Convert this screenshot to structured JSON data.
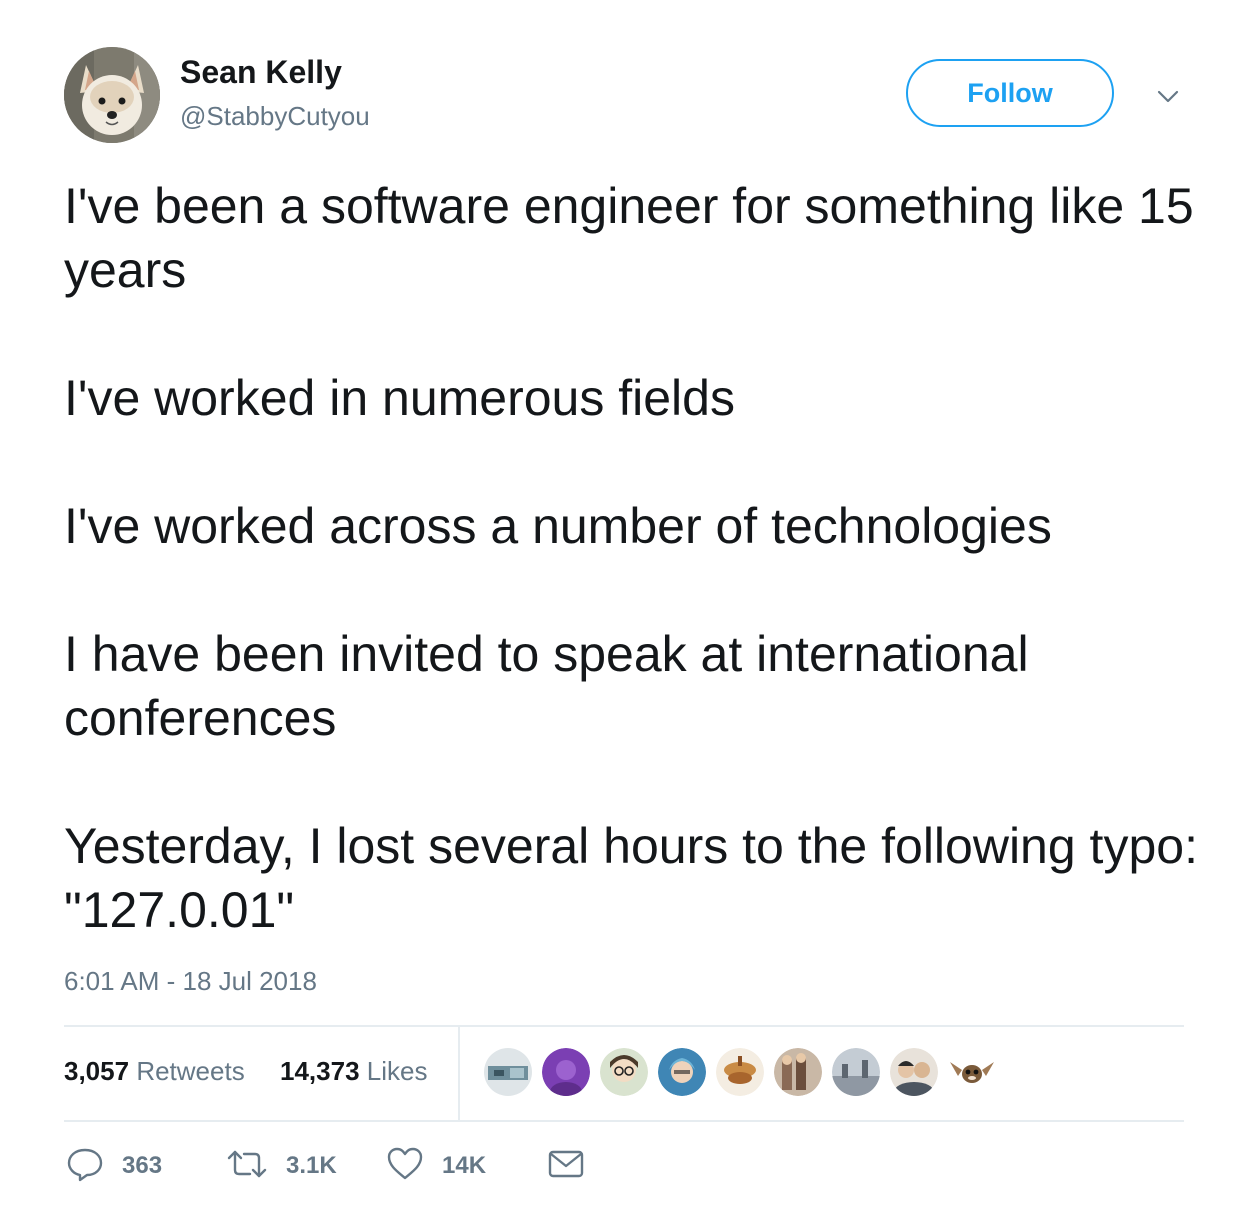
{
  "author": {
    "display_name": "Sean Kelly",
    "handle": "@StabbyCutyou",
    "avatar_icon": "dog-avatar"
  },
  "follow_button": {
    "label": "Follow"
  },
  "menu": {
    "icon": "chevron-down-icon"
  },
  "tweet": {
    "paragraphs": [
      "I've been a software engineer for something like 15 years",
      "I've worked in numerous fields",
      "I've worked across a number of technologies",
      "I have been invited to speak at international conferences",
      "Yesterday, I lost several hours to the following typo: \"127.0.01\""
    ],
    "timestamp": "6:01 AM - 18 Jul 2018"
  },
  "stats": {
    "retweets_count": "3,057",
    "retweets_label": "Retweets",
    "likes_count": "14,373",
    "likes_label": "Likes"
  },
  "likers": [
    {
      "icon": "liker-avatar-1",
      "color": "#6f8f9c"
    },
    {
      "icon": "liker-avatar-2",
      "color": "#7b3fb3"
    },
    {
      "icon": "liker-avatar-3",
      "color": "#3b7a52"
    },
    {
      "icon": "liker-avatar-4",
      "color": "#3f86b5"
    },
    {
      "icon": "liker-avatar-5",
      "color": "#c98b45"
    },
    {
      "icon": "liker-avatar-6",
      "color": "#8a6a55"
    },
    {
      "icon": "liker-avatar-7",
      "color": "#8f98a3"
    },
    {
      "icon": "liker-avatar-8",
      "color": "#4c5560"
    },
    {
      "icon": "liker-avatar-9",
      "color": "#7a5a3a"
    }
  ],
  "actions": {
    "reply_count": "363",
    "retweet_count": "3.1K",
    "like_count": "14K"
  },
  "colors": {
    "accent": "#1da1f2",
    "text": "#14171a",
    "secondary_text": "#657786",
    "divider": "#e6ecf0"
  }
}
